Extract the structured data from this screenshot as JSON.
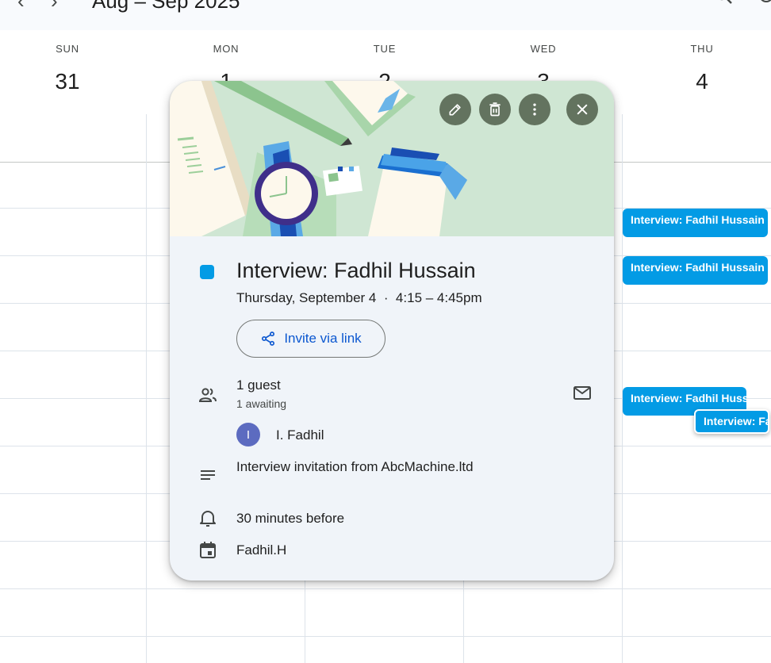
{
  "header": {
    "title": "Aug – Sep 2025",
    "prev_icon": "chevron-left-icon",
    "next_icon": "chevron-right-icon",
    "search_icon": "search-icon",
    "help_icon": "help-icon"
  },
  "days": [
    {
      "dow": "SUN",
      "num": "31"
    },
    {
      "dow": "MON",
      "num": "1"
    },
    {
      "dow": "TUE",
      "num": "2"
    },
    {
      "dow": "WED",
      "num": "3"
    },
    {
      "dow": "THU",
      "num": "4"
    }
  ],
  "calendar_events": [
    {
      "label": "Interview: Fadhil Hussain"
    },
    {
      "label": "Interview: Fadhil Hussain"
    },
    {
      "label": "Interview: Fadhil Hussain"
    },
    {
      "label": "Interview: Fadhil Hussain"
    }
  ],
  "popup": {
    "actions": {
      "edit_icon": "pencil-icon",
      "delete_icon": "trash-icon",
      "more_icon": "more-vert-icon",
      "close_icon": "close-icon"
    },
    "event_color": "#039be5",
    "title": "Interview: Fadhil Hussain",
    "when": "Thursday, September 4  ·  4:15 – 4:45pm",
    "invite_label": "Invite via link",
    "guests": {
      "count_label": "1 guest",
      "status_label": "1 awaiting",
      "list": [
        {
          "initial": "I",
          "name": "I. Fadhil"
        }
      ]
    },
    "description": "Interview invitation from AbcMachine.ltd",
    "reminder": "30 minutes before",
    "calendar_name": "Fadhil.H"
  },
  "colors": {
    "accent": "#0b57d0",
    "event": "#039be5",
    "popup_bg": "#f0f4f9",
    "hero_bg": "#cfe6d3",
    "action_button": "#63735f"
  }
}
